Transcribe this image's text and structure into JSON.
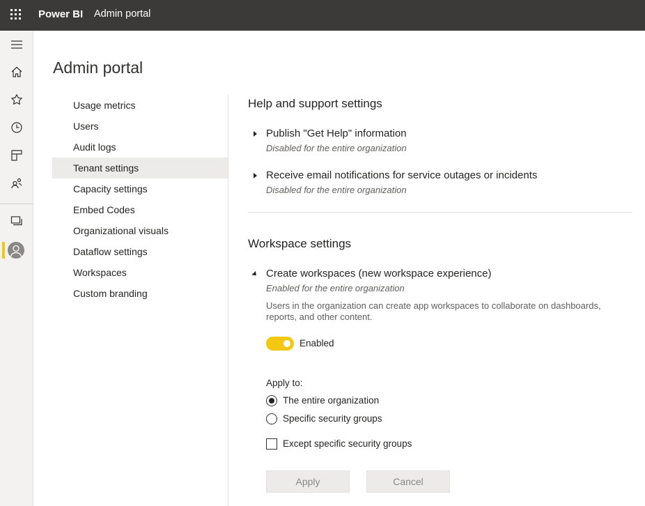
{
  "topbar": {
    "brand": "Power BI",
    "breadcrumb": "Admin portal",
    "waffle_icon": "app-launcher-icon",
    "background": "#3b3a39"
  },
  "leftnav": {
    "icons": [
      "hamburger-icon",
      "home-icon",
      "star-icon",
      "clock-icon",
      "apps-icon",
      "shared-icon",
      "workspaces-icon",
      "avatar"
    ],
    "active_accent": "#f2c811"
  },
  "page": {
    "title": "Admin portal"
  },
  "submenu": {
    "items": [
      "Usage metrics",
      "Users",
      "Audit logs",
      "Tenant settings",
      "Capacity settings",
      "Embed Codes",
      "Organizational visuals",
      "Dataflow settings",
      "Workspaces",
      "Custom branding"
    ],
    "active": "Tenant settings"
  },
  "help": {
    "heading": "Help and support settings",
    "settings": [
      {
        "title": "Publish \"Get Help\" information",
        "status": "Disabled for the entire organization",
        "expanded": false
      },
      {
        "title": "Receive email notifications for service outages or incidents",
        "status": "Disabled for the entire organization",
        "expanded": false
      }
    ]
  },
  "workspace": {
    "heading": "Workspace settings",
    "setting": {
      "title": "Create workspaces (new workspace experience)",
      "status": "Enabled for the entire organization",
      "expanded": true,
      "description": "Users in the organization can create app workspaces to collaborate on dashboards, reports, and other content.",
      "toggle_label": "Enabled",
      "toggle_on": true,
      "apply_to_label": "Apply to:",
      "options": [
        "The entire organization",
        "Specific security groups"
      ],
      "selected_option": "The entire organization",
      "except_label": "Except specific security groups",
      "except_checked": false
    },
    "buttons": {
      "apply": "Apply",
      "cancel": "Cancel"
    }
  }
}
